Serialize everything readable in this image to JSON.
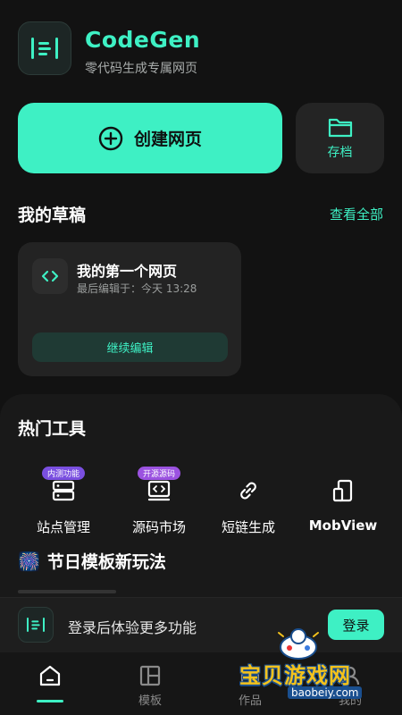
{
  "header": {
    "app_name": "CodeGen",
    "tagline": "零代码生成专属网页"
  },
  "actions": {
    "create_label": "创建网页",
    "archive_label": "存档"
  },
  "drafts": {
    "title": "我的草稿",
    "view_all": "查看全部",
    "items": [
      {
        "name": "我的第一个网页",
        "edited": "最后编辑于：今天 13:28",
        "continue_label": "继续编辑"
      }
    ]
  },
  "tools": {
    "title": "热门工具",
    "items": [
      {
        "label": "站点管理",
        "badge": "内测功能",
        "icon": "server-icon"
      },
      {
        "label": "源码市场",
        "badge": "开源源码",
        "icon": "code-window-icon"
      },
      {
        "label": "短链生成",
        "badge": "",
        "icon": "link-icon"
      },
      {
        "label": "MobView",
        "badge": "",
        "icon": "mobile-view-icon"
      }
    ]
  },
  "holiday": {
    "emoji": "🎆",
    "title": "节日模板新玩法"
  },
  "login_bar": {
    "text": "登录后体验更多功能",
    "button": "登录"
  },
  "nav": {
    "items": [
      {
        "label": "",
        "icon": "home-icon",
        "active": true
      },
      {
        "label": "模板",
        "icon": "template-icon",
        "active": false
      },
      {
        "label": "作品",
        "icon": "works-icon",
        "active": false
      },
      {
        "label": "我的",
        "icon": "profile-icon",
        "active": false
      }
    ]
  },
  "watermark": {
    "title": "宝贝游戏网",
    "url": "baobeiy.com"
  },
  "colors": {
    "accent": "#3ef0c4",
    "background": "#121212",
    "card": "#232323"
  }
}
